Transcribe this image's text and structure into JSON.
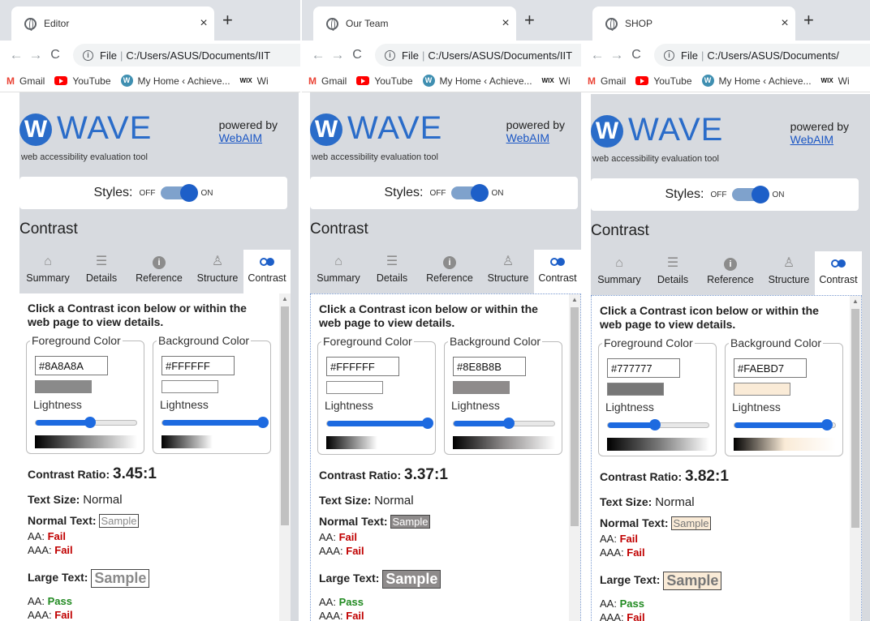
{
  "bookmarks": [
    {
      "icon": "gmail-icon",
      "label": "Gmail"
    },
    {
      "icon": "youtube-icon",
      "label": "YouTube"
    },
    {
      "icon": "wordpress-icon",
      "label": "My Home ‹ Achieve..."
    },
    {
      "icon": "wix-icon",
      "label": "Wi"
    }
  ],
  "wave": {
    "logo_glyph": "W",
    "logo_text": "WAVE",
    "tagline": "web accessibility evaluation tool",
    "powered_by": "powered by",
    "webaim": "WebAIM",
    "styles_label": "Styles:",
    "off": "OFF",
    "on": "ON",
    "section_title": "Contrast",
    "tabs": [
      "Summary",
      "Details",
      "Reference",
      "Structure",
      "Contrast"
    ],
    "intro": "Click a Contrast icon below or within the web page to view details.",
    "fg_legend": "Foreground Color",
    "bg_legend": "Background Color",
    "lightness": "Lightness",
    "ratio_label": "Contrast Ratio:",
    "text_size_label": "Text Size:",
    "normal_text_label": "Normal Text:",
    "large_text_label": "Large Text:",
    "sample": "Sample",
    "aa": "AA:",
    "aaa": "AAA:"
  },
  "panels": [
    {
      "tab_title": "Editor",
      "close": "×",
      "new_tab": "+",
      "url_scheme": "File",
      "url": "C:/Users/ASUS/Documents/IIT",
      "foreground": "#8A8A8A",
      "background": "#FFFFFF",
      "fg_lightness": 0.54,
      "bg_lightness": 1.0,
      "ratio": "3.45:1",
      "text_size": "Normal",
      "normal_aa": "Fail",
      "normal_aaa": "Fail",
      "large_aa": "Pass",
      "large_aaa": "Fail"
    },
    {
      "tab_title": "Our Team",
      "close": "×",
      "new_tab": "+",
      "url_scheme": "File",
      "url": "C:/Users/ASUS/Documents/IIT",
      "foreground": "#FFFFFF",
      "background": "#8E8B8B",
      "fg_lightness": 1.0,
      "bg_lightness": 0.55,
      "ratio": "3.37:1",
      "text_size": "Normal",
      "normal_aa": "Fail",
      "normal_aaa": "Fail",
      "large_aa": "Pass",
      "large_aaa": "Fail"
    },
    {
      "tab_title": "SHOP",
      "close": "×",
      "new_tab": "+",
      "url_scheme": "File",
      "url": "C:/Users/ASUS/Documents/",
      "foreground": "#777777",
      "background": "#FAEBD7",
      "fg_lightness": 0.47,
      "bg_lightness": 0.92,
      "ratio": "3.82:1",
      "text_size": "Normal",
      "normal_aa": "Fail",
      "normal_aaa": "Fail",
      "large_aa": "Pass",
      "large_aaa": "Fail"
    }
  ]
}
